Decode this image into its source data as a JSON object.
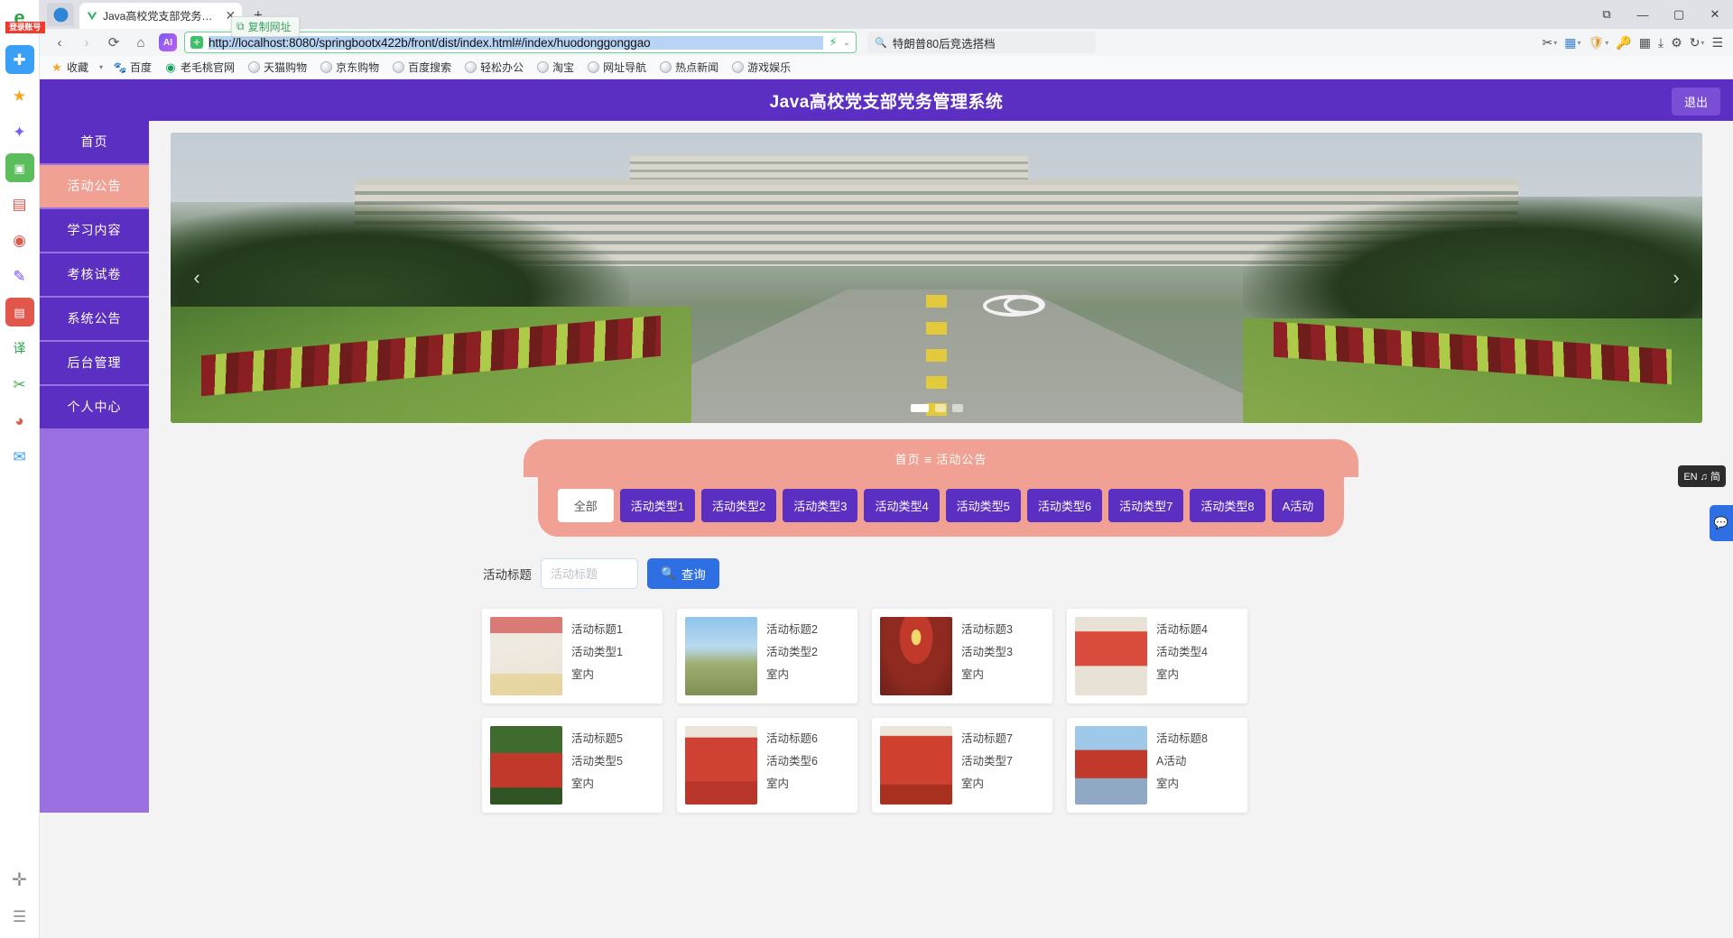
{
  "browser": {
    "tab": {
      "title": "Java高校党支部党务管理系统",
      "favicon": "v-logo-icon",
      "close": "✕"
    },
    "new_tab": "+",
    "tooltip": {
      "text": "复制网址",
      "icon": "copy-icon"
    },
    "window_controls": {
      "restore_down": "⧉",
      "minimize": "—",
      "maximize": "▢",
      "close": "✕"
    },
    "nav": {
      "back": "‹",
      "forward": "›",
      "reload": "⟳",
      "home": "⌂",
      "ai": "AI"
    },
    "url": "http://localhost:8080/springbootx422b/front/dist/index.html#/index/huodonggonggao",
    "url_shield": "✛",
    "url_bolt": "⚡",
    "url_chevron": "⌄",
    "search": {
      "placeholder": "",
      "value": "特朗普80后竞选搭档",
      "icon": "search-icon"
    },
    "toolbar_icons": [
      {
        "name": "scissors-icon",
        "glyph": "✂"
      },
      {
        "name": "palette-icon",
        "glyph": "🎨"
      },
      {
        "name": "shield-icon",
        "glyph": "🛡"
      },
      {
        "name": "key-icon",
        "glyph": "🔑"
      },
      {
        "name": "grid-apps-icon",
        "glyph": "▦"
      },
      {
        "name": "download-icon",
        "glyph": "⤓"
      },
      {
        "name": "gear-icon",
        "glyph": "⚙"
      },
      {
        "name": "history-icon",
        "glyph": "↻"
      },
      {
        "name": "menu-icon",
        "glyph": "☰"
      }
    ],
    "bookmarks": [
      {
        "label": "收藏",
        "icon": "star-icon"
      },
      {
        "label": "百度",
        "icon": "baidu-icon"
      },
      {
        "label": "老毛桃官网",
        "icon": "laomaotao-icon"
      },
      {
        "label": "天猫购物",
        "icon": "globe-icon"
      },
      {
        "label": "京东购物",
        "icon": "globe-icon"
      },
      {
        "label": "百度搜索",
        "icon": "globe-icon"
      },
      {
        "label": "轻松办公",
        "icon": "globe-icon"
      },
      {
        "label": "淘宝",
        "icon": "globe-icon"
      },
      {
        "label": "网址导航",
        "icon": "globe-icon"
      },
      {
        "label": "热点新闻",
        "icon": "globe-icon"
      },
      {
        "label": "游戏娱乐",
        "icon": "globe-icon"
      }
    ],
    "dock": [
      {
        "name": "browser-logo-icon",
        "glyph": "e",
        "color": "#2aa34a",
        "badge": "登录账号"
      },
      {
        "name": "add-panel-icon",
        "glyph": "✚",
        "color": "#3aa0f5"
      },
      {
        "name": "favorites-icon",
        "glyph": "★",
        "color": "#f5a623"
      },
      {
        "name": "ai-assistant-icon",
        "glyph": "✦",
        "color": "#7d5cf5"
      },
      {
        "name": "image-icon",
        "glyph": "🖼",
        "color": "#4caf50"
      },
      {
        "name": "pdf-icon",
        "glyph": "📄",
        "color": "#e2574c"
      },
      {
        "name": "location-icon",
        "glyph": "◉",
        "color": "#e2574c"
      },
      {
        "name": "edit-icon",
        "glyph": "✎",
        "color": "#7c4dff"
      },
      {
        "name": "note-icon",
        "glyph": "▤",
        "color": "#e2574c"
      },
      {
        "name": "translate-icon",
        "glyph": "译",
        "color": "#2aa34a"
      },
      {
        "name": "scissors-icon",
        "glyph": "✂",
        "color": "#4caf50"
      },
      {
        "name": "eye-icon",
        "glyph": "◕",
        "color": "#e2574c"
      },
      {
        "name": "mail-icon",
        "glyph": "✉",
        "color": "#3aa0f5"
      },
      {
        "name": "add-icon",
        "glyph": "✛",
        "color": "#777"
      },
      {
        "name": "list-icon",
        "glyph": "☰",
        "color": "#777"
      }
    ]
  },
  "page": {
    "site_title": "Java高校党支部党务管理系统",
    "logout_label": "退出",
    "sidebar": [
      {
        "label": "首页",
        "active": false
      },
      {
        "label": "活动公告",
        "active": true
      },
      {
        "label": "学习内容",
        "active": false
      },
      {
        "label": "考核试卷",
        "active": false
      },
      {
        "label": "系统公告",
        "active": false
      },
      {
        "label": "后台管理",
        "active": false
      },
      {
        "label": "个人中心",
        "active": false
      }
    ],
    "carousel": {
      "prev": "‹",
      "next": "›",
      "slides": 3,
      "active_slide": 1
    },
    "breadcrumb": "首页 ≡ 活动公告",
    "type_filters": [
      {
        "label": "全部",
        "selected": true
      },
      {
        "label": "活动类型1",
        "selected": false
      },
      {
        "label": "活动类型2",
        "selected": false
      },
      {
        "label": "活动类型3",
        "selected": false
      },
      {
        "label": "活动类型4",
        "selected": false
      },
      {
        "label": "活动类型5",
        "selected": false
      },
      {
        "label": "活动类型6",
        "selected": false
      },
      {
        "label": "活动类型7",
        "selected": false
      },
      {
        "label": "活动类型8",
        "selected": false
      },
      {
        "label": "A活动",
        "selected": false
      }
    ],
    "search": {
      "label": "活动标题",
      "placeholder": "活动标题",
      "value": "",
      "button": "查询",
      "button_icon": "search-icon"
    },
    "cards": [
      {
        "title": "活动标题1",
        "type": "活动类型1",
        "place": "室内",
        "thumb": "poster-red-frame"
      },
      {
        "title": "活动标题2",
        "type": "活动类型2",
        "place": "室内",
        "thumb": "outdoor-red-monument"
      },
      {
        "title": "活动标题3",
        "type": "活动类型3",
        "place": "室内",
        "thumb": "hall-party-emblem"
      },
      {
        "title": "活动标题4",
        "type": "活动类型4",
        "place": "室内",
        "thumb": "red-display-board"
      },
      {
        "title": "活动标题5",
        "type": "活动类型5",
        "place": "室内",
        "thumb": "outdoor-red-flag"
      },
      {
        "title": "活动标题6",
        "type": "活动类型6",
        "place": "室内",
        "thumb": "red-hall-interior"
      },
      {
        "title": "活动标题7",
        "type": "活动类型7",
        "place": "室内",
        "thumb": "red-stage"
      },
      {
        "title": "活动标题8",
        "type": "A活动",
        "place": "室内",
        "thumb": "red-monument-sky"
      }
    ],
    "float_widgets": {
      "lang": "EN ♫ 简",
      "feedback_icon": "chat-icon"
    },
    "colors": {
      "primary": "#5b2fc2",
      "sidebar_bg": "#9a6fe0",
      "accent_pink": "#f0a193",
      "search_blue": "#2f6fe4"
    }
  }
}
